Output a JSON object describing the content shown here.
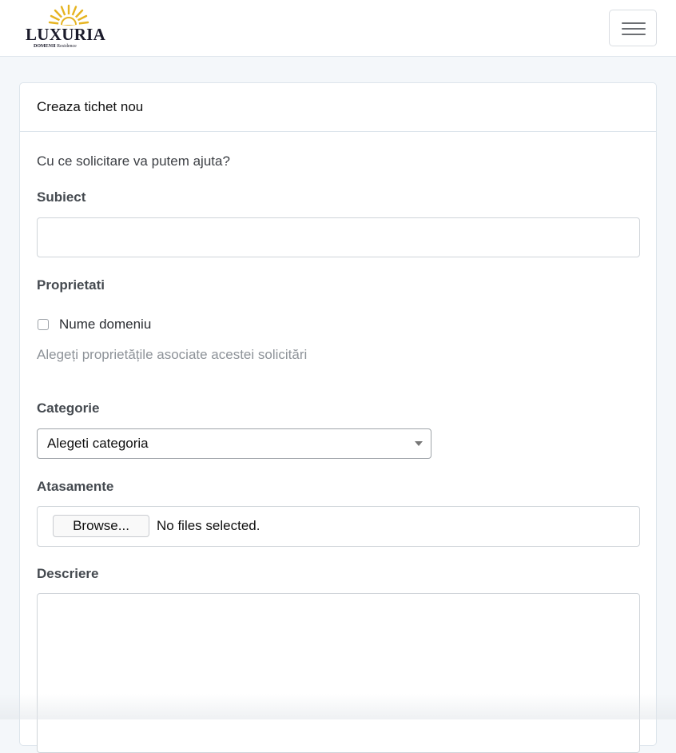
{
  "navbar": {
    "logo": {
      "name": "LUXURIA",
      "sub_bold": "DOMENII",
      "sub_regular": "Residence",
      "accent_color": "#e6b422"
    },
    "menu_toggle_icon": "hamburger-icon"
  },
  "card": {
    "title": "Creaza tichet nou",
    "intro": "Cu ce solicitare va putem ajuta?",
    "subject": {
      "label": "Subiect",
      "value": ""
    },
    "properties": {
      "label": "Proprietati",
      "options": [
        {
          "label": "Nume domeniu",
          "checked": false
        }
      ],
      "help": "Alegeți proprietățile asociate acestei solicitări"
    },
    "category": {
      "label": "Categorie",
      "selected": "Alegeti categoria"
    },
    "attachments": {
      "label": "Atasamente",
      "button": "Browse...",
      "status": "No files selected."
    },
    "description": {
      "label": "Descriere",
      "value": ""
    }
  }
}
